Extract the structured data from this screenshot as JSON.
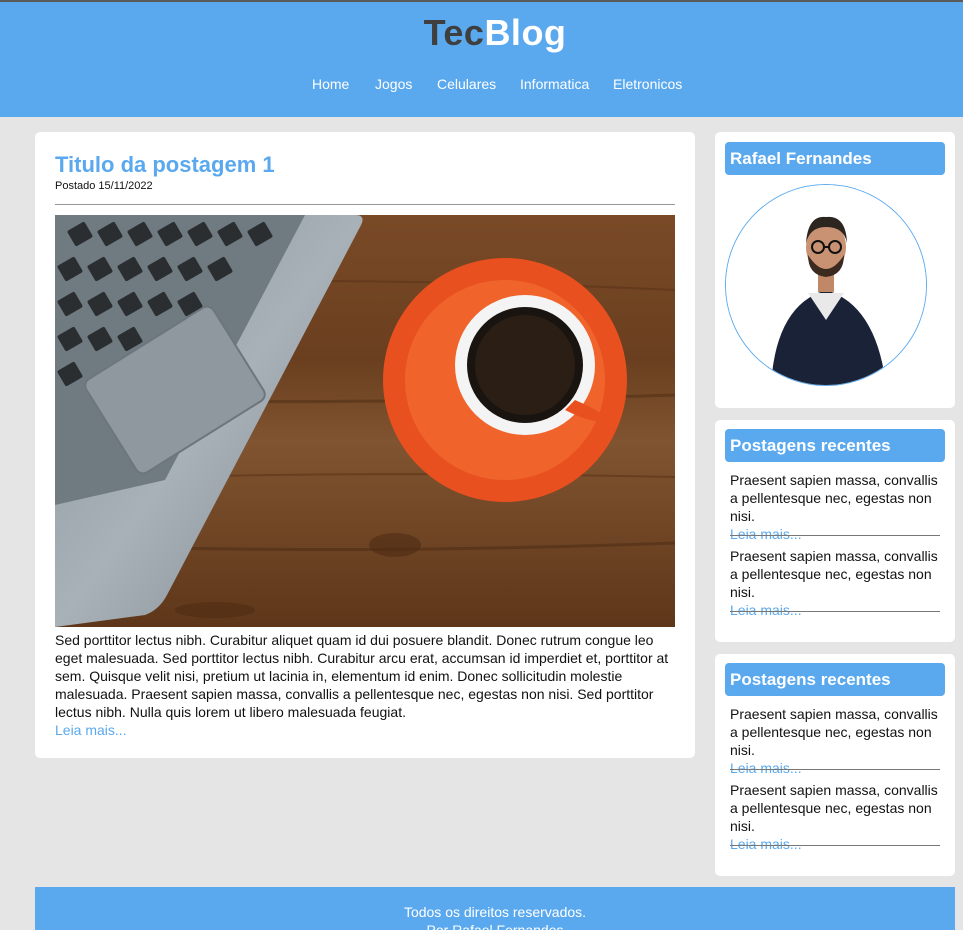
{
  "header": {
    "logo_part1": "Tec",
    "logo_part2": "Blog",
    "nav": [
      "Home",
      "Jogos",
      "Celulares",
      "Informatica",
      "Eletronicos"
    ]
  },
  "post": {
    "title": "Titulo da postagem 1",
    "date": "Postado 15/11/2022",
    "body": "Sed porttitor lectus nibh. Curabitur aliquet quam id dui posuere blandit. Donec rutrum congue leo eget malesuada. Sed porttitor lectus nibh. Curabitur arcu erat, accumsan id imperdiet et, porttitor at sem. Quisque velit nisi, pretium ut lacinia in, elementum id enim. Donec sollicitudin molestie malesuada. Praesent sapien massa, convallis a pellentesque nec, egestas non nisi. Sed porttitor lectus nibh. Nulla quis lorem ut libero malesuada feugiat.",
    "more": "Leia mais..."
  },
  "profile": {
    "name": "Rafael Fernandes"
  },
  "recent1": {
    "title": "Postagens recentes",
    "items": [
      {
        "text": "Praesent sapien massa, convallis a pellentesque nec, egestas non nisi.",
        "more": "Leia mais..."
      },
      {
        "text": "Praesent sapien massa, convallis a pellentesque nec, egestas non nisi.",
        "more": "Leia mais..."
      }
    ]
  },
  "recent2": {
    "title": "Postagens recentes",
    "items": [
      {
        "text": "Praesent sapien massa, convallis a pellentesque nec, egestas non nisi.",
        "more": "Leia mais..."
      },
      {
        "text": "Praesent sapien massa, convallis a pellentesque nec, egestas non nisi.",
        "more": "Leia mais..."
      }
    ]
  },
  "footer": {
    "line1": "Todos os direitos reservados.",
    "line2": "Por Rafael Fernandes"
  },
  "colors": {
    "accent": "#5aa9ef",
    "logo_dark": "#3f3f3f",
    "background": "#e5e5e5"
  }
}
